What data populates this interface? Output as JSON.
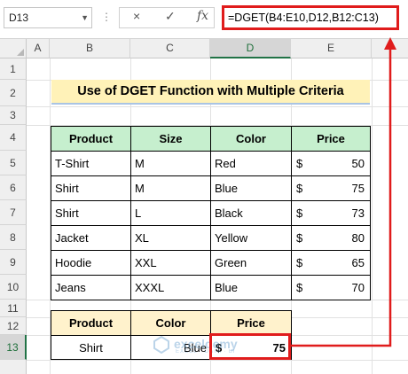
{
  "formula_bar": {
    "name_box": "D13",
    "cancel_icon": "×",
    "enter_icon": "✓",
    "fx_icon": "fx",
    "formula": "=DGET(B4:E10,D12,B12:C13)"
  },
  "columns": [
    "A",
    "B",
    "C",
    "D",
    "E"
  ],
  "rows": [
    "1",
    "2",
    "3",
    "4",
    "5",
    "6",
    "7",
    "8",
    "9",
    "10",
    "11",
    "12",
    "13"
  ],
  "title": "Use of DGET Function with Multiple Criteria",
  "table": {
    "headers": [
      "Product",
      "Size",
      "Color",
      "Price"
    ],
    "currency": "$",
    "rows": [
      {
        "product": "T-Shirt",
        "size": "M",
        "color": "Red",
        "price": "50"
      },
      {
        "product": "Shirt",
        "size": "M",
        "color": "Blue",
        "price": "75"
      },
      {
        "product": "Shirt",
        "size": "L",
        "color": "Black",
        "price": "73"
      },
      {
        "product": "Jacket",
        "size": "XL",
        "color": "Yellow",
        "price": "80"
      },
      {
        "product": "Hoodie",
        "size": "XXL",
        "color": "Green",
        "price": "65"
      },
      {
        "product": "Jeans",
        "size": "XXXL",
        "color": "Blue",
        "price": "70"
      }
    ]
  },
  "criteria": {
    "headers": [
      "Product",
      "Color",
      "Price"
    ],
    "product": "Shirt",
    "color": "Blue",
    "currency": "$",
    "result": "75"
  },
  "watermark": {
    "name": "exceldemy",
    "sub": "EXCEL · DATA · BI"
  },
  "colors": {
    "accent": "#e01c1c",
    "header_green": "#c6efce",
    "header_yellow": "#fff2cc",
    "title_bg": "#fff2b8"
  }
}
